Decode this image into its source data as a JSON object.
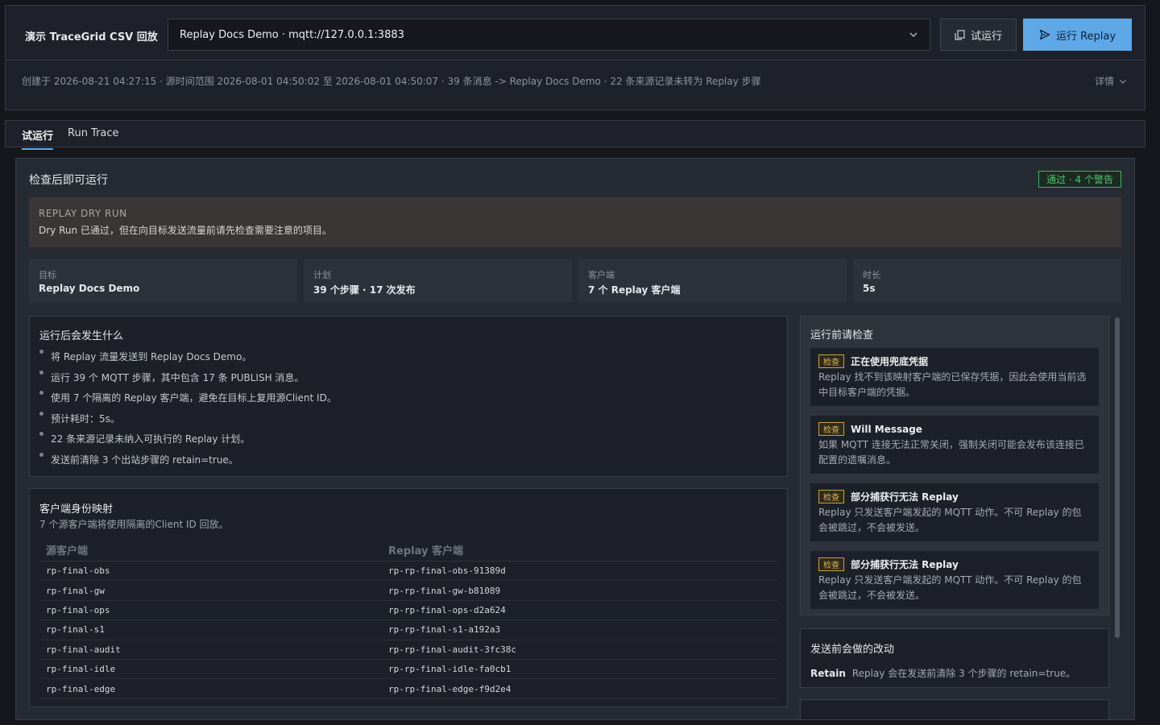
{
  "header": {
    "title": "演示 TraceGrid CSV 回放",
    "target_select": "Replay Docs Demo · mqtt://127.0.0.1:3883",
    "try_button": "试运行",
    "run_button": "运行 Replay",
    "meta": "创建于 2026-08-21 04:27:15 · 源时间范围 2026-08-01 04:50:02 至 2026-08-01 04:50:07 · 39 条消息 -> Replay Docs Demo · 22 条来源记录未转为 Replay 步骤",
    "details": "详情"
  },
  "tabs": [
    {
      "label": "试运行",
      "active": true
    },
    {
      "label": "Run Trace",
      "active": false
    }
  ],
  "dryrun": {
    "title": "检查后即可运行",
    "badge": "通过 · 4 个警告",
    "badge_color": "#49c76b",
    "notice_kicker": "REPLAY DRY RUN",
    "notice_text": "Dry Run 已通过，但在向目标发送流量前请先检查需要注意的项目。",
    "stats": [
      {
        "label": "目标",
        "value": "Replay Docs Demo"
      },
      {
        "label": "计划",
        "value": "39 个步骤 · 17 次发布"
      },
      {
        "label": "客户端",
        "value": "7 个 Replay 客户端"
      },
      {
        "label": "时长",
        "value": "5s"
      }
    ]
  },
  "what_happens": {
    "title": "运行后会发生什么",
    "items": [
      "将 Replay 流量发送到 Replay Docs Demo。",
      "运行 39 个 MQTT 步骤，其中包含 17 条 PUBLISH 消息。",
      "使用 7 个隔离的 Replay 客户端，避免在目标上复用源Client ID。",
      "预计耗时：5s。",
      "22 条来源记录未纳入可执行的 Replay 计划。",
      "发送前清除 3 个出站步骤的 retain=true。"
    ]
  },
  "client_map": {
    "title": "客户端身份映射",
    "subtitle": "7 个源客户端将使用隔离的Client ID 回放。",
    "col_source": "源客户端",
    "col_replay": "Replay 客户端",
    "rows": [
      [
        "rp-final-obs",
        "rp-rp-final-obs-91389d"
      ],
      [
        "rp-final-gw",
        "rp-rp-final-gw-b81089"
      ],
      [
        "rp-final-ops",
        "rp-rp-final-ops-d2a624"
      ],
      [
        "rp-final-s1",
        "rp-rp-final-s1-a192a3"
      ],
      [
        "rp-final-audit",
        "rp-rp-final-audit-3fc38c"
      ],
      [
        "rp-final-idle",
        "rp-rp-final-idle-fa0cb1"
      ],
      [
        "rp-final-edge",
        "rp-rp-final-edge-f9d2e4"
      ]
    ]
  },
  "prechecks": {
    "title": "运行前请检查",
    "tag": "检查",
    "items": [
      {
        "title": "正在使用兜底凭据",
        "desc": "Replay 找不到该映射客户端的已保存凭据，因此会使用当前选中目标客户端的凭据。"
      },
      {
        "title": "Will Message",
        "desc": "如果 MQTT 连接无法正常关闭，强制关闭可能会发布该连接已配置的遗嘱消息。"
      },
      {
        "title": "部分捕获行无法 Replay",
        "desc": "Replay 只发送客户端发起的 MQTT 动作。不可 Replay 的包会被跳过，不会被发送。"
      },
      {
        "title": "部分捕获行无法 Replay",
        "desc": "Replay 只发送客户端发起的 MQTT 动作。不可 Replay 的包会被跳过，不会被发送。"
      }
    ]
  },
  "changes": {
    "title": "发送前会做的改动",
    "key": "Retain",
    "text": "Replay 会在发送前清除 3 个步骤的 retain=true。"
  }
}
